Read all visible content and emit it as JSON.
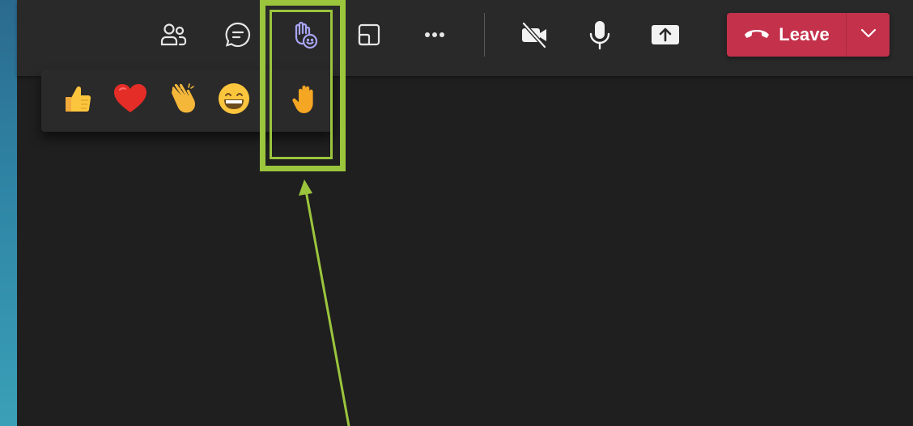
{
  "toolbar": {
    "buttons": [
      {
        "name": "people-icon"
      },
      {
        "name": "chat-icon"
      },
      {
        "name": "react-icon"
      },
      {
        "name": "room-icon"
      },
      {
        "name": "more-icon"
      },
      {
        "name": "camera-off-icon"
      },
      {
        "name": "mic-icon"
      },
      {
        "name": "share-icon"
      }
    ],
    "leave_label": "Leave"
  },
  "reactions": [
    {
      "name": "like",
      "glyph": "👍"
    },
    {
      "name": "heart",
      "glyph": "❤️"
    },
    {
      "name": "applause",
      "glyph": "👏"
    },
    {
      "name": "laugh",
      "glyph": "😁"
    },
    {
      "name": "raise-hand",
      "glyph": "✋"
    }
  ],
  "colors": {
    "toolbar_bg": "#292929",
    "stage_bg": "#1f1f1f",
    "leave_red": "#c4314b",
    "react_accent": "#a8a4f5",
    "highlight": "#9bc53d"
  }
}
